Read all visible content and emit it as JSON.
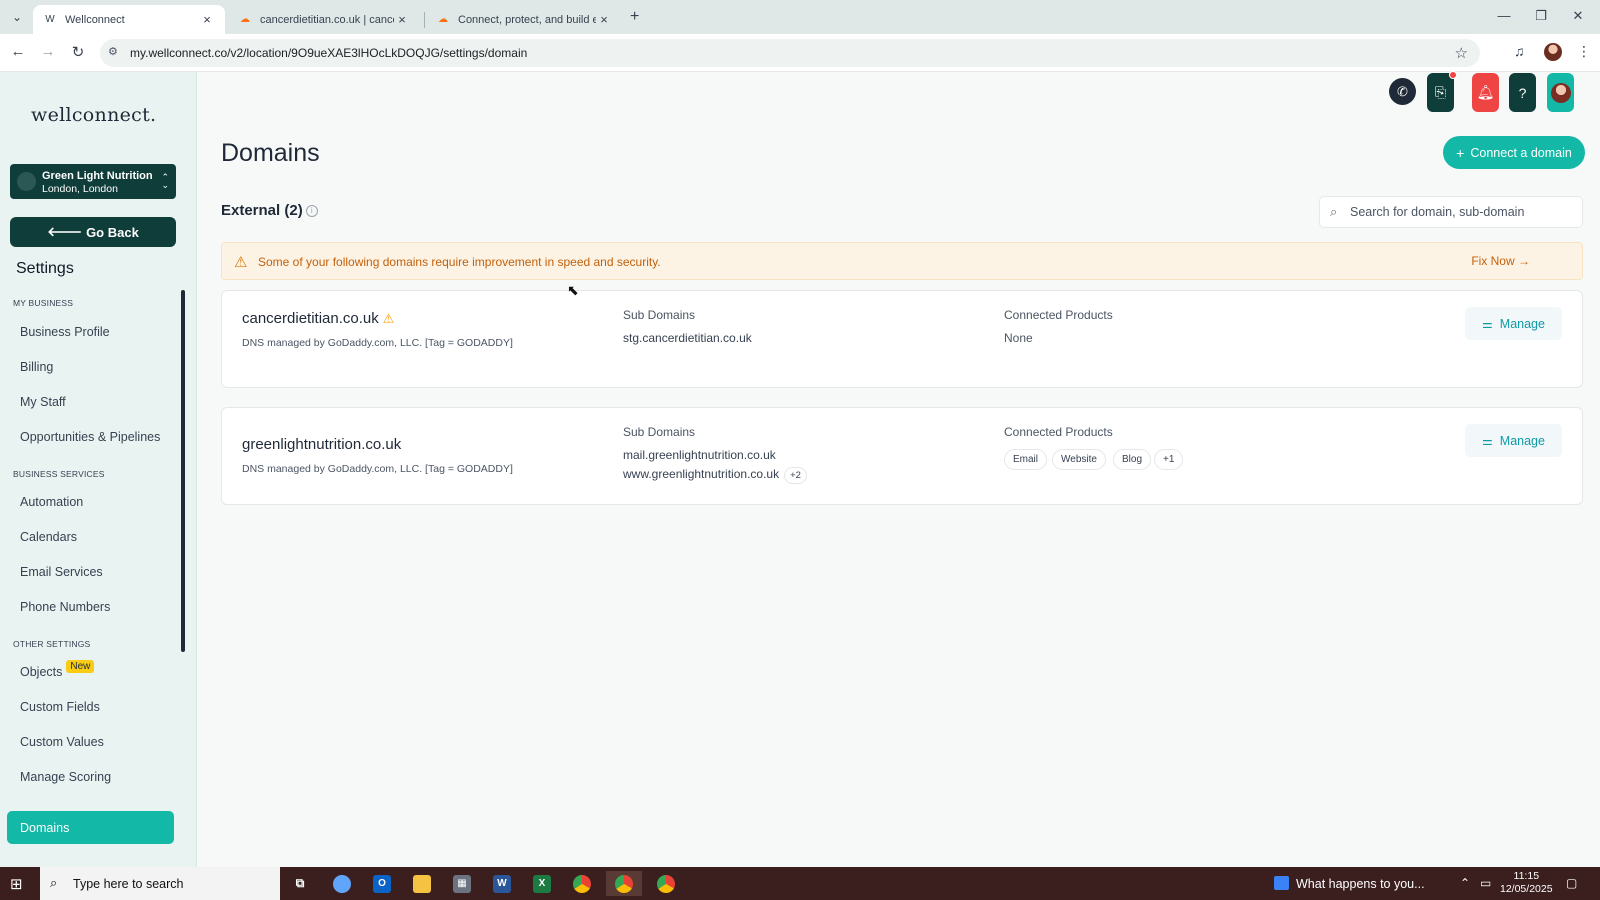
{
  "browser": {
    "tabs": [
      {
        "title": "Wellconnect",
        "active": true
      },
      {
        "title": "cancerdietitian.co.uk | cancerdi",
        "active": false
      },
      {
        "title": "Connect, protect, and build eve",
        "active": false
      }
    ],
    "url": "my.wellconnect.co/v2/location/9O9ueXAE3lHOcLkDOQJG/settings/domain"
  },
  "sidebar": {
    "logo": "wellconnect.",
    "location": {
      "name": "Green Light Nutrition",
      "city": "London, London"
    },
    "go_back": "Go Back",
    "settings_title": "Settings",
    "sections": {
      "my_business": "MY BUSINESS",
      "business_services": "BUSINESS SERVICES",
      "other_settings": "OTHER SETTINGS"
    },
    "items": {
      "business_profile": "Business Profile",
      "billing": "Billing",
      "my_staff": "My Staff",
      "opportunities": "Opportunities & Pipelines",
      "automation": "Automation",
      "calendars": "Calendars",
      "email_services": "Email Services",
      "phone_numbers": "Phone Numbers",
      "objects": "Objects",
      "objects_badge": "New",
      "custom_fields": "Custom Fields",
      "custom_values": "Custom Values",
      "manage_scoring": "Manage Scoring",
      "domains": "Domains"
    }
  },
  "main": {
    "title": "Domains",
    "connect_button": "Connect a domain",
    "external_label": "External (2)",
    "search_placeholder": "Search for domain, sub-domain",
    "warning": {
      "message": "Some of your following domains require improvement in speed and security.",
      "action": "Fix Now"
    },
    "labels": {
      "sub_domains": "Sub Domains",
      "connected_products": "Connected Products",
      "manage": "Manage"
    },
    "domains": [
      {
        "name": "cancerdietitian.co.uk",
        "dns": "DNS managed by GoDaddy.com, LLC. [Tag = GODADDY]",
        "sub_domains": [
          "stg.cancerdietitian.co.uk"
        ],
        "connected_products_text": "None"
      },
      {
        "name": "greenlightnutrition.co.uk",
        "dns": "DNS managed by GoDaddy.com, LLC. [Tag = GODADDY]",
        "sub_domains": [
          "mail.greenlightnutrition.co.uk",
          "www.greenlightnutrition.co.uk"
        ],
        "sub_domains_more": "+2",
        "products": [
          "Email",
          "Website",
          "Blog"
        ],
        "products_more": "+1"
      }
    ]
  },
  "taskbar": {
    "search_text": "Type here to search",
    "weather_text": "What happens to you...",
    "time": "11:15",
    "date": "12/05/2025"
  },
  "colors": {
    "accent": "#14b8a6",
    "dark_teal": "#0f3d3a",
    "warning_bg": "#fdf3e4",
    "warning_text": "#c2610c",
    "alert_red": "#ef4444"
  }
}
